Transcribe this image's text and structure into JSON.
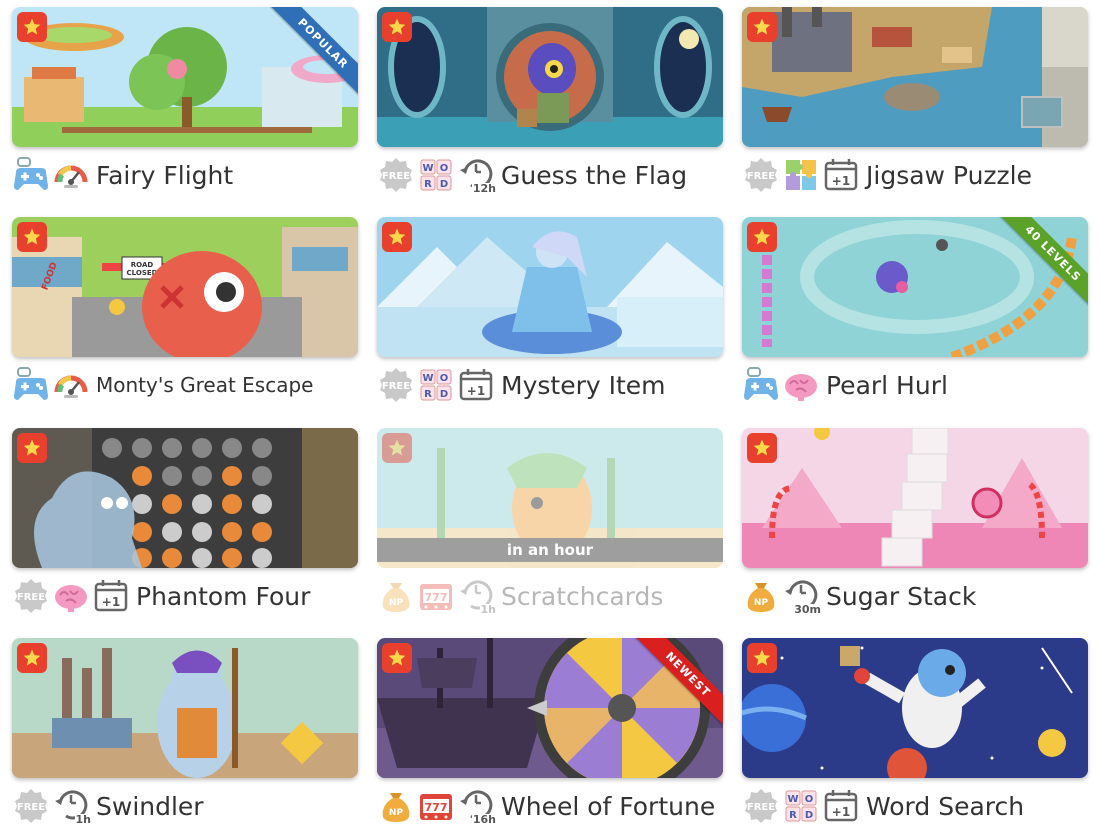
{
  "colors": {
    "fav_bg": "#e8402d",
    "popular_ribbon": "#2e6fb8",
    "levels_ribbon": "#5aa328",
    "newest_ribbon": "#d9201f",
    "cooldown_bg": "#9e9e9e"
  },
  "games": [
    {
      "title": "Fairy Flight",
      "ribbon": "POPULAR",
      "icons": [
        "gamepad-icon",
        "speed-gauge-icon"
      ]
    },
    {
      "title": "Guess the Flag",
      "icons": [
        "free-badge-icon",
        "word-tiles-icon",
        "timer-icon"
      ],
      "timer": "12h"
    },
    {
      "title": "Jigsaw Puzzle",
      "icons": [
        "free-badge-icon",
        "puzzle-pieces-icon",
        "calendar-plus-one-icon"
      ],
      "calendar": "+1"
    },
    {
      "title": "Monty's Great Escape",
      "icons": [
        "gamepad-icon",
        "speed-gauge-icon"
      ]
    },
    {
      "title": "Mystery Item",
      "icons": [
        "free-badge-icon",
        "word-tiles-icon",
        "calendar-plus-one-icon"
      ],
      "calendar": "+1"
    },
    {
      "title": "Pearl Hurl",
      "ribbon": "40 LEVELS",
      "icons": [
        "gamepad-icon",
        "brain-icon"
      ]
    },
    {
      "title": "Phantom Four",
      "icons": [
        "free-badge-icon",
        "brain-icon",
        "calendar-plus-one-icon"
      ],
      "calendar": "+1"
    },
    {
      "title": "Scratchcards",
      "cooldown": "in an hour",
      "icons": [
        "money-bag-icon",
        "slot-777-icon",
        "timer-icon"
      ],
      "timer": "1h"
    },
    {
      "title": "Sugar Stack",
      "icons": [
        "money-bag-icon",
        "timer-icon"
      ],
      "timer": "30m"
    },
    {
      "title": "Swindler",
      "icons": [
        "free-badge-icon",
        "timer-icon"
      ],
      "timer": "1h"
    },
    {
      "title": "Wheel of Fortune",
      "ribbon": "NEWEST",
      "icons": [
        "money-bag-icon",
        "slot-777-icon",
        "timer-icon"
      ],
      "timer": "16h"
    },
    {
      "title": "Word Search",
      "icons": [
        "free-badge-icon",
        "word-tiles-icon",
        "calendar-plus-one-icon"
      ],
      "calendar": "+1"
    }
  ],
  "labels": {
    "free": "FREE",
    "word_letters": [
      "W",
      "O",
      "R",
      "D"
    ],
    "slot": "777",
    "road_sign": [
      "ROAD",
      "CLOSED"
    ],
    "bag": "NP",
    "food_sign": "FOOD"
  }
}
